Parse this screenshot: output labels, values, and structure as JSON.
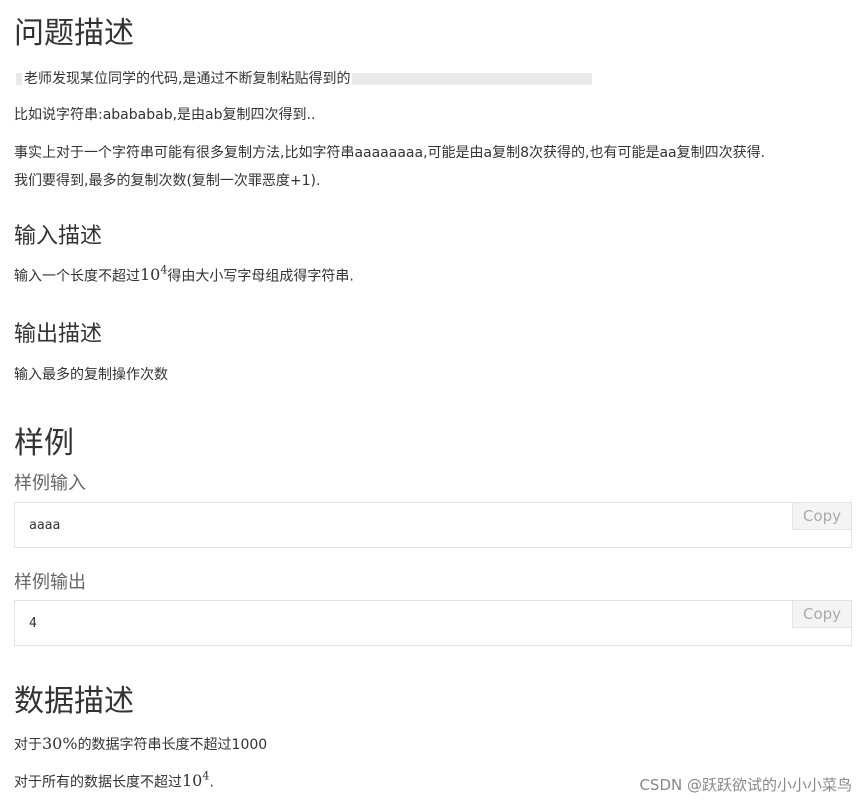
{
  "problem": {
    "heading": "问题描述",
    "line1": "老师发现某位同学的代码,是通过不断复制粘贴得到的",
    "line1_tail": "\"\"",
    "line2": "比如说字符串:abababab,是由ab复制四次得到..",
    "line3": "事实上对于一个字符串可能有很多复制方法,比如字符串aaaaaaaa,可能是由a复制8次获得的,也有可能是aa复制四次获得.",
    "line4": "我们要得到,最多的复制次数(复制一次罪恶度+1)."
  },
  "input_desc": {
    "heading": "输入描述",
    "pre": "输入一个长度不超过",
    "math_base": "10",
    "math_exp": "4",
    "post": "得由大小写字母组成得字符串."
  },
  "output_desc": {
    "heading": "输出描述",
    "text": "输入最多的复制操作次数"
  },
  "samples": {
    "heading": "样例",
    "input_label": "样例输入",
    "input_value": "aaaa",
    "output_label": "样例输出",
    "output_value": "4",
    "copy_label": "Copy"
  },
  "data_desc": {
    "heading": "数据描述",
    "line1_pre": "对于",
    "line1_math": "30%",
    "line1_post": "的数据字符串长度不超过1000",
    "line2_pre": "对于所有的数据长度不超过",
    "line2_base": "10",
    "line2_exp": "4",
    "line2_post": "."
  },
  "watermark": "CSDN @跃跃欲试的小小小菜鸟"
}
